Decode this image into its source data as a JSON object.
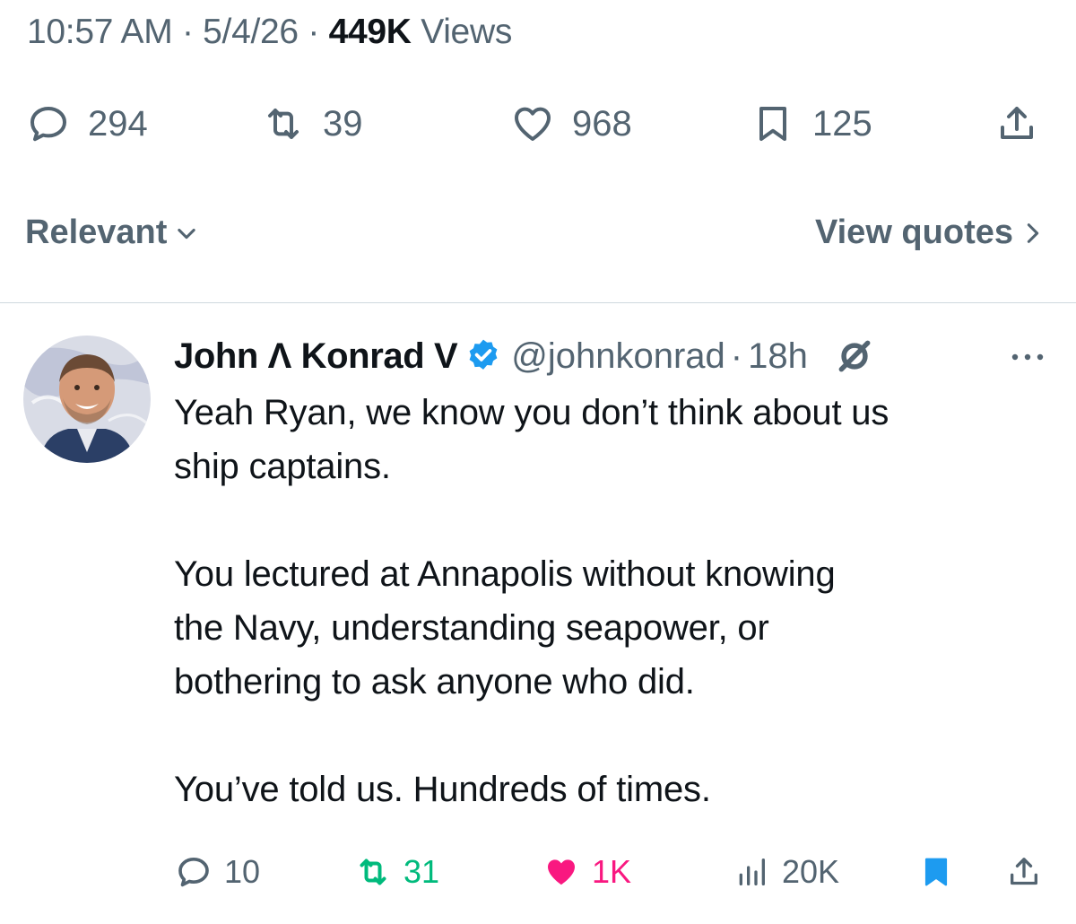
{
  "tweet": {
    "time": "10:57 AM",
    "date": "5/4/26",
    "separator": "·",
    "views_count": "449K",
    "views_label": "Views",
    "actions": {
      "replies": "294",
      "reposts": "39",
      "likes": "968",
      "bookmarks": "125"
    }
  },
  "replies_section": {
    "sort_label": "Relevant",
    "view_quotes_label": "View quotes"
  },
  "reply": {
    "author_name": "John Λ Konrad V",
    "handle": "@johnkonrad",
    "separator": "·",
    "time_ago": "18h",
    "paragraphs": [
      "Yeah Ryan, we know you don’t think about us\nship captains.",
      "You lectured at Annapolis without knowing\nthe Navy, understanding seapower, or\nbothering to ask anyone who did.",
      "You’ve told us. Hundreds of times."
    ],
    "actions": {
      "replies": "10",
      "reposts": "31",
      "likes": "1K",
      "views": "20K"
    }
  },
  "colors": {
    "text_primary": "#0f1419",
    "text_secondary": "#536471",
    "verified_blue": "#1d9bf0",
    "repost_green": "#00ba7c",
    "like_pink": "#f91880"
  },
  "icons": {
    "reply": "speech-bubble-icon",
    "repost": "repost-arrows-icon",
    "like": "heart-icon",
    "bookmark": "bookmark-icon",
    "share": "share-upload-icon",
    "verified": "verified-badge-icon",
    "grok": "grok-icon",
    "more": "more-dots-icon",
    "views": "bar-chart-icon",
    "sort": "chevron-down-icon",
    "quotes": "chevron-right-icon"
  }
}
